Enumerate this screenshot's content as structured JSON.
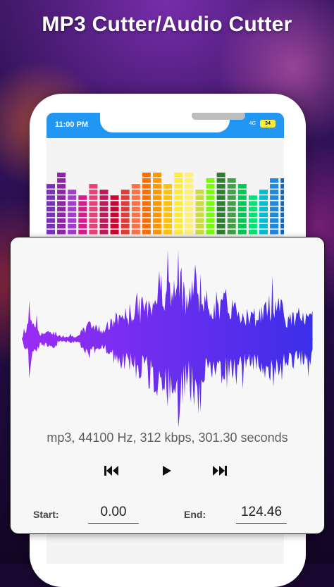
{
  "header": {
    "title": "MP3 Cutter/Audio Cutter"
  },
  "phone": {
    "status_time": "11:00 PM",
    "network_label": "4G",
    "battery_level": "34",
    "equalizer_colors": [
      "#7b2fbf",
      "#8e24aa",
      "#a43bd6",
      "#d81b8f",
      "#ec407a",
      "#c2185b",
      "#d50032",
      "#e53935",
      "#ff7043",
      "#ff6d00",
      "#ff9800",
      "#ffc107",
      "#ffeb3b",
      "#fff176",
      "#cddc39",
      "#76ff03",
      "#2e7d32",
      "#43a047",
      "#00c853",
      "#00e676",
      "#00bcd4",
      "#1e88e5",
      "#1565c0"
    ],
    "equalizer_levels": [
      0.78,
      0.88,
      0.7,
      0.62,
      0.78,
      0.7,
      0.62,
      0.7,
      0.78,
      0.95,
      0.9,
      0.78,
      0.95,
      0.88,
      0.7,
      0.8,
      0.92,
      0.85,
      0.78,
      0.62,
      0.66,
      0.8,
      0.85
    ]
  },
  "editor": {
    "waveform_colors": [
      "#9b2cf5",
      "#3b2fe8"
    ],
    "info": "mp3, 44100 Hz, 312 kbps, 301.30 seconds",
    "controls": {
      "rewind_icon": "skip-previous-icon",
      "play_icon": "play-icon",
      "forward_icon": "skip-next-icon"
    },
    "start_label": "Start:",
    "start_value": "0.00",
    "end_label": "End:",
    "end_value": "124.46"
  }
}
